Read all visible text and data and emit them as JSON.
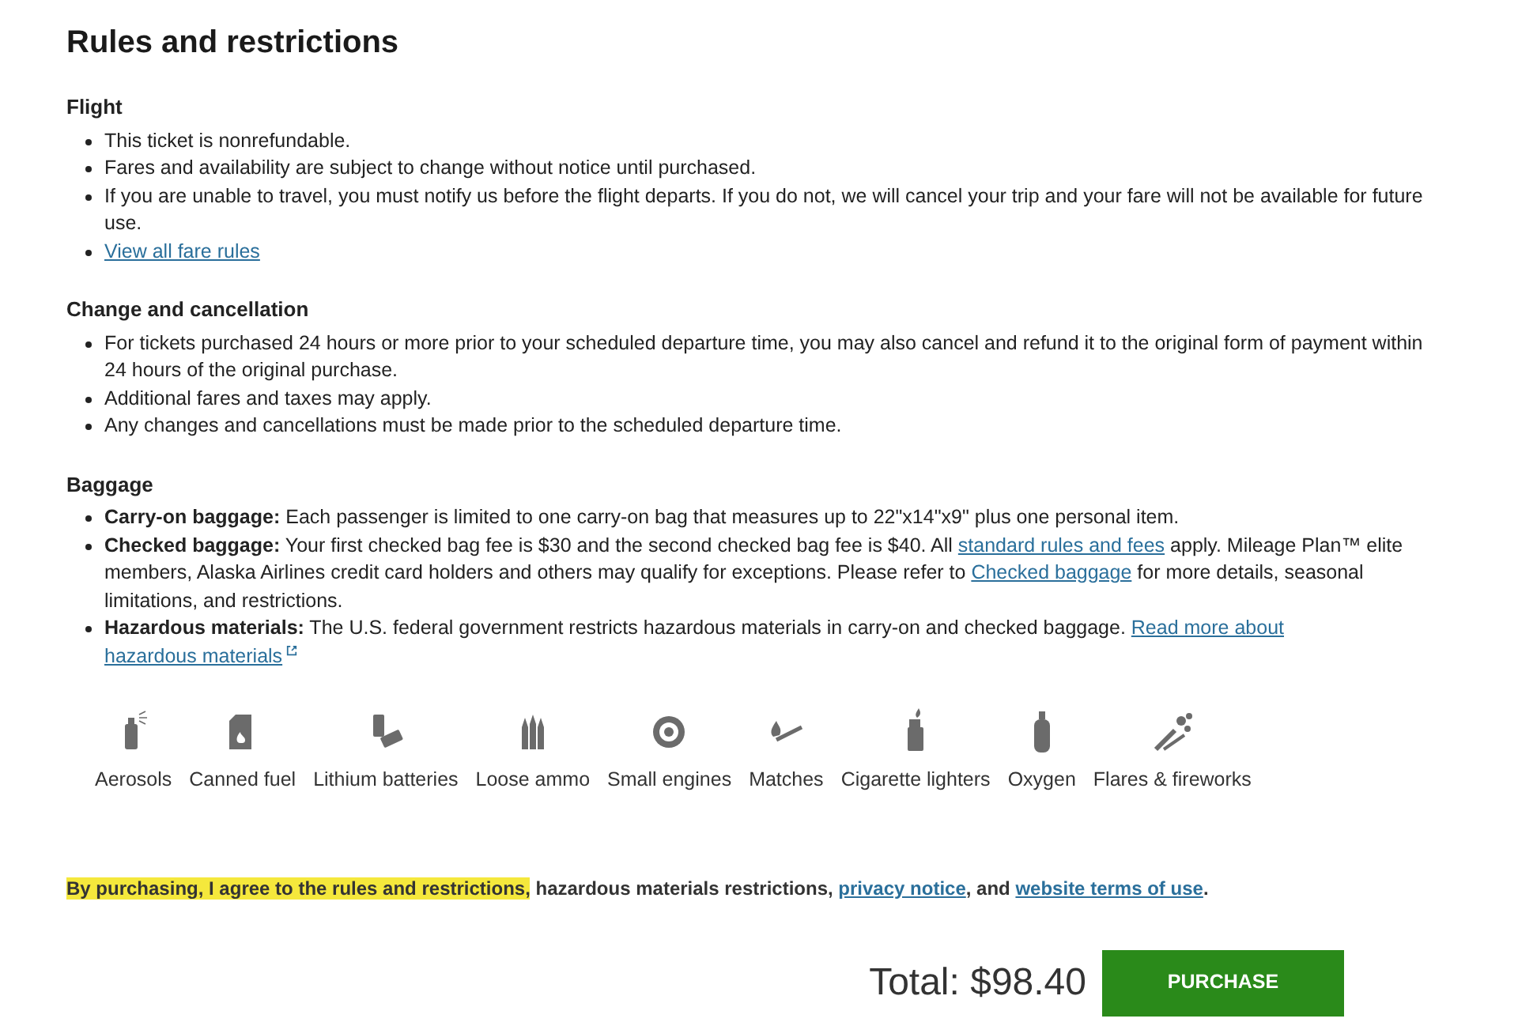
{
  "title": "Rules and restrictions",
  "sections": [
    {
      "heading": "Flight",
      "items": [
        [
          {
            "kind": "text",
            "text": "This ticket is nonrefundable."
          }
        ],
        [
          {
            "kind": "text",
            "text": "Fares and availability are subject to change without notice until purchased."
          }
        ],
        [
          {
            "kind": "text",
            "text": "If you are unable to travel, you must notify us before the flight departs. If you do not, we will cancel your trip and your fare will not be available for future use."
          }
        ],
        [
          {
            "kind": "link",
            "text": "View all fare rules"
          }
        ]
      ]
    },
    {
      "heading": "Change and cancellation",
      "items": [
        [
          {
            "kind": "text",
            "text": "For tickets purchased 24 hours or more prior to your scheduled departure time, you may also cancel and refund it to the original form of payment within 24 hours of the original purchase."
          }
        ],
        [
          {
            "kind": "text",
            "text": "Additional fares and taxes may apply."
          }
        ],
        [
          {
            "kind": "text",
            "text": "Any changes and cancellations must be made prior to the scheduled departure time."
          }
        ]
      ]
    },
    {
      "heading": "Baggage",
      "items": [
        [
          {
            "kind": "bold",
            "text": "Carry-on baggage:"
          },
          {
            "kind": "text",
            "text": " Each passenger is limited to one carry-on bag that measures up to 22\"x14\"x9\" plus one personal item."
          }
        ],
        [
          {
            "kind": "bold",
            "text": "Checked baggage:"
          },
          {
            "kind": "text",
            "text": " Your first checked bag fee is $30 and the second checked bag fee is $40. All "
          },
          {
            "kind": "link",
            "text": "standard rules and fees"
          },
          {
            "kind": "text",
            "text": " apply. Mileage Plan™ elite members, Alaska Airlines credit card holders and others may qualify for exceptions. Please refer to "
          },
          {
            "kind": "link",
            "text": "Checked baggage"
          },
          {
            "kind": "text",
            "text": " for more details, seasonal limitations, and restrictions."
          }
        ],
        [
          {
            "kind": "bold",
            "text": "Hazardous materials:"
          },
          {
            "kind": "text",
            "text": " The U.S. federal government restricts hazardous materials in carry-on and checked baggage. "
          },
          {
            "kind": "link",
            "text": "Read more about"
          },
          {
            "kind": "external",
            "text": "hazardous materials"
          }
        ]
      ]
    }
  ],
  "hazards": [
    "Aerosols",
    "Canned fuel",
    "Lithium batteries",
    "Loose ammo",
    "Small engines",
    "Matches",
    "Cigarette lighters",
    "Oxygen",
    "Flares & fireworks"
  ],
  "agreement": [
    {
      "kind": "highlight",
      "text": "By purchasing, I agree to the rules and restrictions,"
    },
    {
      "kind": "text",
      "text": " hazardous materials restrictions, "
    },
    {
      "kind": "link",
      "text": "privacy notice"
    },
    {
      "kind": "text",
      "text": ", and "
    },
    {
      "kind": "link",
      "text": "website terms of use"
    },
    {
      "kind": "text",
      "text": "."
    }
  ],
  "total": "Total: $98.40",
  "purchase_button": "PURCHASE"
}
